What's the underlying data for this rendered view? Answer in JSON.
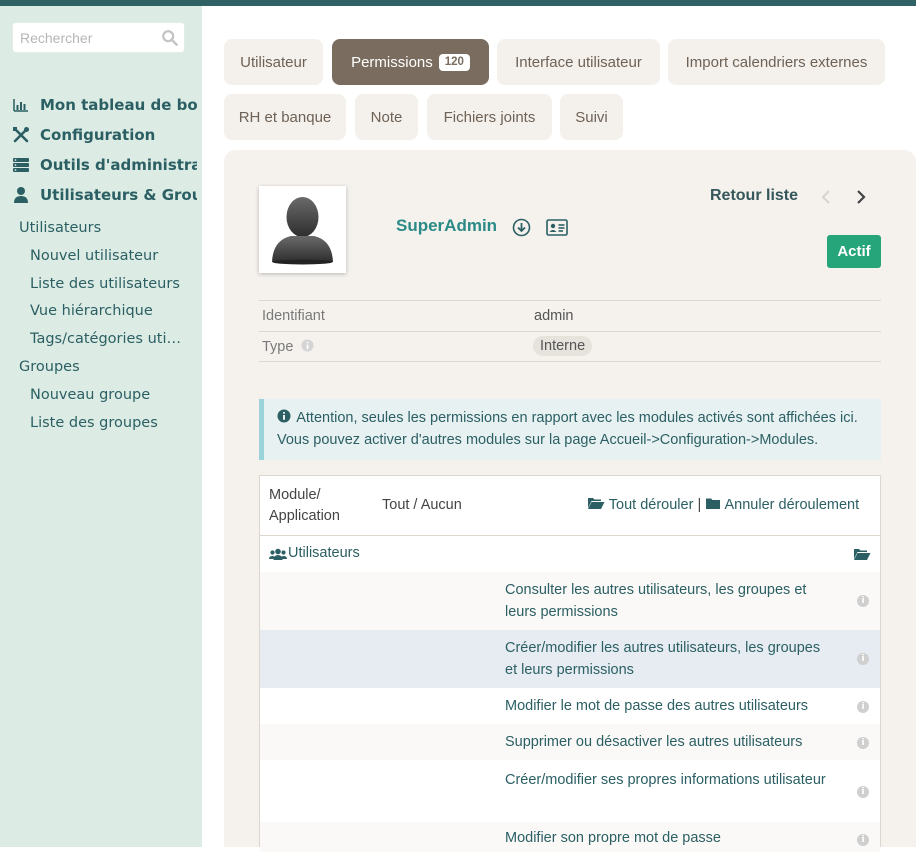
{
  "search": {
    "placeholder": "Rechercher"
  },
  "sidebar": {
    "main_items": [
      {
        "label": "Mon tableau de bord",
        "icon": "chart-icon"
      },
      {
        "label": "Configuration",
        "icon": "tools-icon"
      },
      {
        "label": "Outils d'administration",
        "icon": "server-icon"
      },
      {
        "label": "Utilisateurs & Groupes",
        "icon": "user-icon"
      }
    ],
    "sub_items": [
      {
        "label": "Utilisateurs",
        "level": 1
      },
      {
        "label": "Nouvel utilisateur",
        "level": 2
      },
      {
        "label": "Liste des utilisateurs",
        "level": 2
      },
      {
        "label": "Vue hiérarchique",
        "level": 2
      },
      {
        "label": "Tags/catégories utilisateurs",
        "level": 2
      },
      {
        "label": "Groupes",
        "level": 1
      },
      {
        "label": "Nouveau groupe",
        "level": 2
      },
      {
        "label": "Liste des groupes",
        "level": 2
      }
    ]
  },
  "tabs": [
    {
      "label": "Utilisateur"
    },
    {
      "label": "Permissions",
      "badge": "120",
      "active": true
    },
    {
      "label": "Interface utilisateur"
    },
    {
      "label": "Import calendriers externes"
    },
    {
      "label": "RH et banque"
    },
    {
      "label": "Note"
    },
    {
      "label": "Fichiers joints"
    },
    {
      "label": "Suivi"
    }
  ],
  "user": {
    "name": "SuperAdmin",
    "status": "Actif",
    "back_label": "Retour liste"
  },
  "info": [
    {
      "label": "Identifiant",
      "value": "admin"
    },
    {
      "label": "Type",
      "value": "Interne"
    }
  ],
  "alert": {
    "text": "Attention, seules les permissions en rapport avec les modules activés sont affichées ici. Vous pouvez activer d'autres modules sur la page Accueil->Configuration->Modules."
  },
  "table": {
    "header": {
      "module": "Module/ Application",
      "all_none": "Tout / Aucun",
      "expand_all": "Tout dérouler",
      "separator": "|",
      "collapse": "Annuler déroulement"
    },
    "group": {
      "label": "Utilisateurs"
    },
    "permissions": [
      "Consulter les autres utilisateurs, les groupes et leurs permissions",
      "Créer/modifier les autres utilisateurs, les groupes et leurs permissions",
      "Modifier le mot de passe des autres utilisateurs",
      "Supprimer ou désactiver les autres utilisateurs",
      "Créer/modifier ses propres informations utilisateur",
      "Modifier son propre mot de passe"
    ]
  },
  "colors": {
    "topbar": "#2f6165",
    "sidebar_bg": "#dcece4",
    "accent_text": "#2b5f63",
    "active_tab": "#7a6d5f",
    "status_green": "#27a57a",
    "username": "#2b8a86"
  }
}
